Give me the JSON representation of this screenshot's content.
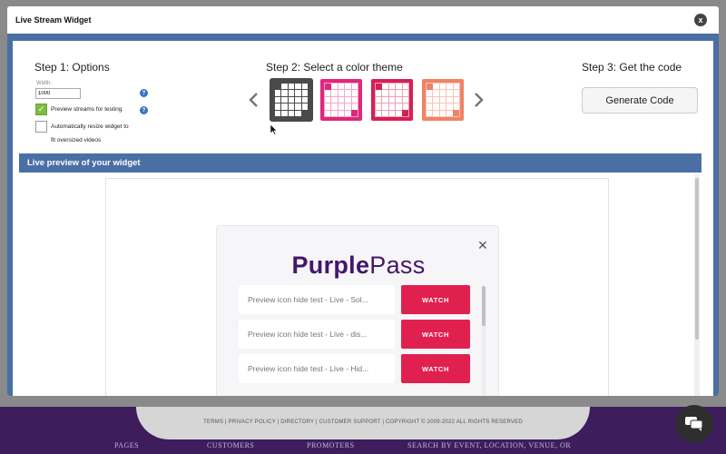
{
  "modal": {
    "title": "Live Stream Widget",
    "close_label": "x"
  },
  "step1": {
    "title": "Step 1: Options",
    "width_label": "Width:",
    "width_value": "1000",
    "preview_streams_label": "Preview streams for testing",
    "preview_streams_checked": true,
    "auto_resize_label_line1": "Automatically resize widget to",
    "auto_resize_label_line2": "fit oversized videos",
    "auto_resize_checked": false,
    "help_glyph": "?"
  },
  "step2": {
    "title": "Step 2: Select a color theme",
    "themes": [
      {
        "name": "dark",
        "color": "#4a4a4a",
        "selected": true
      },
      {
        "name": "magenta",
        "color": "#e0267d",
        "selected": false
      },
      {
        "name": "crimson",
        "color": "#d61f55",
        "selected": false
      },
      {
        "name": "coral",
        "color": "#f08267",
        "selected": false
      }
    ]
  },
  "step3": {
    "title": "Step 3: Get the code",
    "generate_label": "Generate Code"
  },
  "preview": {
    "bar_title": "Live preview of your widget",
    "logo_bold": "Purple",
    "logo_regular": "Pass",
    "close_glyph": "✕",
    "rows": [
      {
        "title": "Preview icon hide test - Live - Sol...",
        "button": "WATCH"
      },
      {
        "title": "Preview icon hide test - Live - dis...",
        "button": "WATCH"
      },
      {
        "title": "Preview icon hide test - Live - Hid...",
        "button": "WATCH"
      }
    ]
  },
  "background_page": {
    "footer_links": "TERMS  |  PRIVACY POLICY  |  DIRECTORY  |  CUSTOMER SUPPORT  |  COPYRIGHT © 2009-2022 ALL RIGHTS RESERVED",
    "nav": [
      "PAGES",
      "CUSTOMERS",
      "PROMOTERS",
      "SEARCH BY EVENT, LOCATION, VENUE, OR"
    ]
  },
  "colors": {
    "accent_blue": "#4a6fa5",
    "watch_red": "#e02150",
    "brand_purple": "#45156b",
    "footer_purple": "#3d1d5c"
  }
}
